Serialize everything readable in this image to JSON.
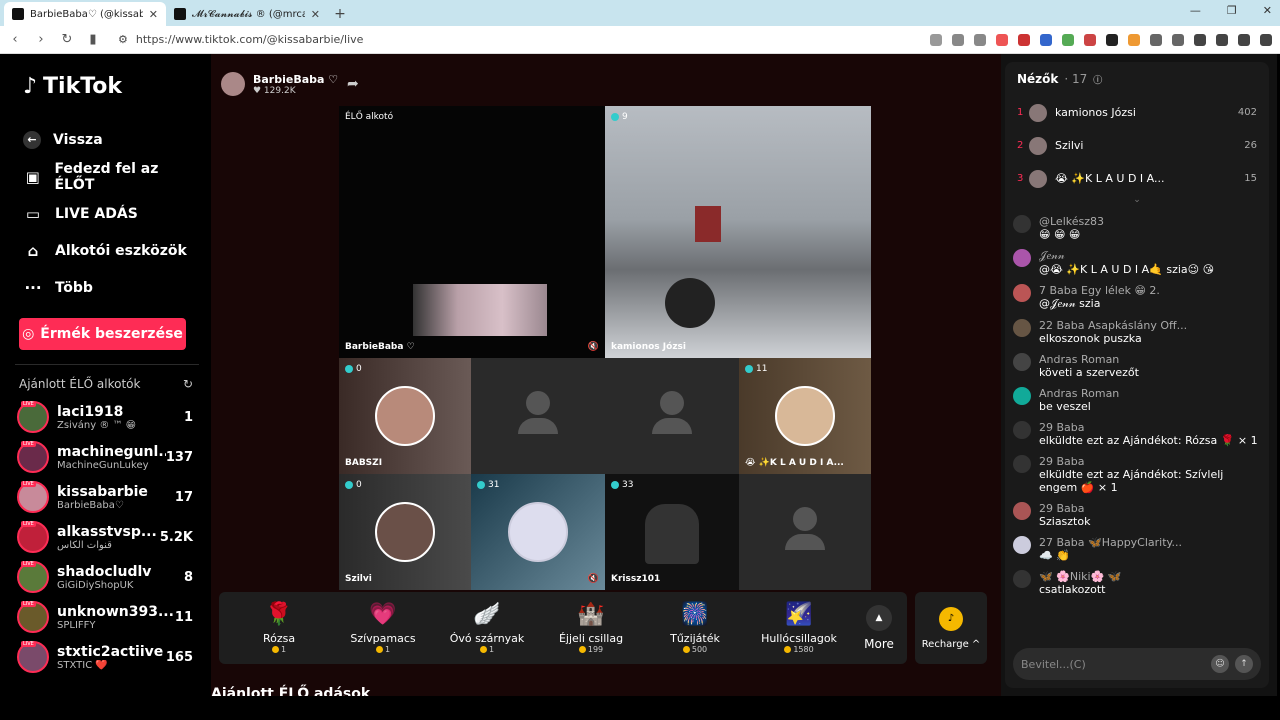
{
  "browser": {
    "tabs": [
      {
        "title": "BarbieBaba♡ (@kissabarbie",
        "active": true
      },
      {
        "title": "𝓜𝓻𝓒𝓪𝓷𝓷𝓪𝓫𝓲𝓼 ® (@mrcannabis_)",
        "active": false
      }
    ],
    "url": "https://www.tiktok.com/@kissabarbie/live"
  },
  "logo": "TikTok",
  "nav": {
    "back": "Vissza",
    "items": [
      "Fedezd fel az ÉLŐT",
      "LIVE ADÁS",
      "Alkotói eszközök",
      "Több"
    ],
    "coin_button": "Érmék beszerzése"
  },
  "recommended": {
    "title": "Ajánlott ÉLŐ alkotók",
    "creators": [
      {
        "name": "laci1918",
        "sub": "Zsivány ® ™ 😁",
        "count": "1"
      },
      {
        "name": "machinegunl...",
        "sub": "MachineGunLukey",
        "count": "137"
      },
      {
        "name": "kissabarbie",
        "sub": "BarbieBaba♡",
        "count": "17"
      },
      {
        "name": "alkasstvsp...",
        "sub": "قنوات الكأس",
        "count": "5.2K"
      },
      {
        "name": "shadocludlv",
        "sub": "GiGiDiyShopUK",
        "count": "8"
      },
      {
        "name": "unknown393...",
        "sub": "SPLIFFY",
        "count": "11"
      },
      {
        "name": "stxtic2actiive",
        "sub": "STXTIC ❤️",
        "count": "165"
      }
    ]
  },
  "stream": {
    "host_name": "BarbieBaba ♡",
    "host_likes": "♥ 129.2K",
    "cells": [
      {
        "badge": "ÉLŐ alkotó",
        "label": "BarbieBaba ♡"
      },
      {
        "badge": "9",
        "label": "kamionos Józsi"
      },
      {
        "badge": "0",
        "label": "BABSZI"
      },
      {
        "badge": "",
        "label": ""
      },
      {
        "badge": "",
        "label": ""
      },
      {
        "badge": "11",
        "label": "😭 ✨K L A U D I A..."
      },
      {
        "badge": "0",
        "label": "Szilvi"
      },
      {
        "badge": "31",
        "label": ""
      },
      {
        "badge": "33",
        "label": "Krissz101"
      },
      {
        "badge": "",
        "label": ""
      }
    ]
  },
  "gifts": [
    {
      "name": "Rózsa",
      "price": "1",
      "icon": "🌹"
    },
    {
      "name": "Szívpamacs",
      "price": "1",
      "icon": "💗"
    },
    {
      "name": "Óvó szárnyak",
      "price": "1",
      "icon": "🪽"
    },
    {
      "name": "Éjjeli csillag",
      "price": "199",
      "icon": "🏰"
    },
    {
      "name": "Tűzijáték",
      "price": "500",
      "icon": "🎆"
    },
    {
      "name": "Hullócsillagok",
      "price": "1580",
      "icon": "🌠"
    }
  ],
  "more_label": "More",
  "recharge_label": "Recharge ^",
  "bottom_title": "Ajánlott ÉLŐ adások",
  "viewers": {
    "title": "Nézők",
    "count": "· 17",
    "list": [
      {
        "rank": "1",
        "name": "kamionos Józsi",
        "score": "402"
      },
      {
        "rank": "2",
        "name": "Szilvi",
        "score": "26"
      },
      {
        "rank": "3",
        "name": "😭 ✨K L A U D I A...",
        "score": "15"
      }
    ]
  },
  "chat": [
    {
      "name": "@Lelkész83",
      "text": "😁 😁 😁"
    },
    {
      "name": "𝒥𝑒𝓃𝓃",
      "text": "@😭 ✨K L A U D I A🤙 szia😉 😘"
    },
    {
      "name": "7 Baba Egy lélek 😁 2.",
      "text": "@𝒥𝑒𝓃𝓃 szia"
    },
    {
      "name": "22 Baba Asapkáslány Off...",
      "text": "elkoszonok puszka"
    },
    {
      "name": "Andras Roman",
      "text": "követi a szervezőt"
    },
    {
      "name": "Andras Roman",
      "text": "be veszel"
    },
    {
      "name": "29 Baba",
      "text": "elküldte ezt az Ajándékot: Rózsa 🌹 × 1"
    },
    {
      "name": "29 Baba",
      "text": "elküldte ezt az Ajándékot: Szívlelj engem 🍎 × 1"
    },
    {
      "name": "29 Baba",
      "text": "Sziasztok"
    },
    {
      "name": "27 Baba 🦋HappyClarity...",
      "text": "☁️ 👏"
    },
    {
      "name": "🦋 🌸Niki🌸 🦋",
      "text": "csatlakozott"
    }
  ],
  "chat_input_placeholder": "Bevitel...(C)"
}
